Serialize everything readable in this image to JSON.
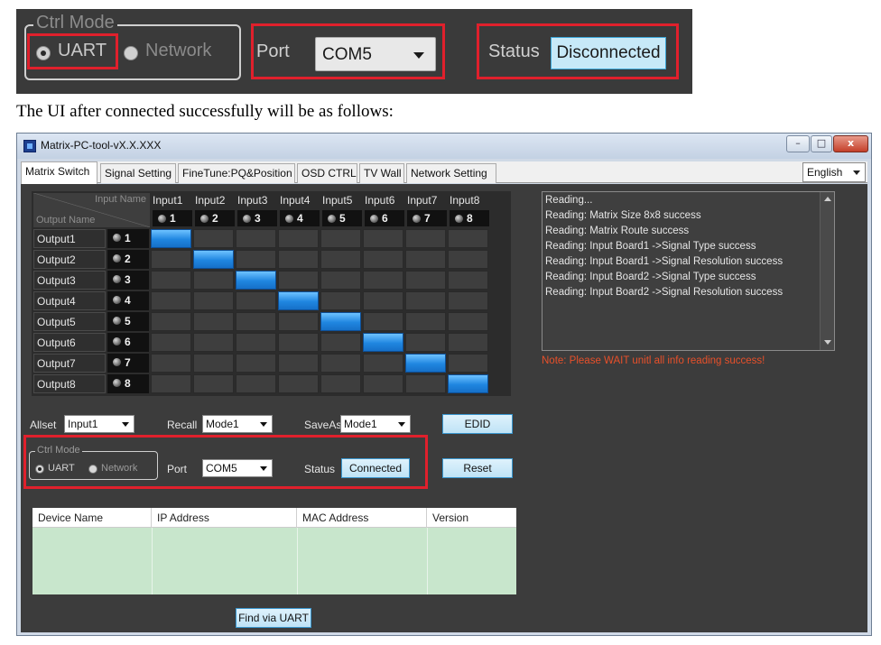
{
  "zoom": {
    "ctrl_mode_legend": "Ctrl Mode",
    "uart_label": "UART",
    "network_label": "Network",
    "port_label": "Port",
    "port_value": "COM5",
    "status_label": "Status",
    "status_value": "Disconnected"
  },
  "caption": "The UI after connected successfully will be as follows:",
  "window": {
    "title": "Matrix-PC-tool-vX.X.XXX",
    "buttons": {
      "minimize": "–",
      "maximize": "□",
      "close": "x"
    }
  },
  "tabs": [
    "Matrix Switch",
    "Signal Setting",
    "FineTune:PQ&Position",
    "OSD CTRL",
    "TV Wall",
    "Network Setting"
  ],
  "active_tab": "Matrix Switch",
  "language": "English",
  "matrix": {
    "corner_input": "Input Name",
    "corner_output": "Output Name",
    "inputs": [
      {
        "name": "Input1",
        "num": "1"
      },
      {
        "name": "Input2",
        "num": "2"
      },
      {
        "name": "Input3",
        "num": "3"
      },
      {
        "name": "Input4",
        "num": "4"
      },
      {
        "name": "Input5",
        "num": "5"
      },
      {
        "name": "Input6",
        "num": "6"
      },
      {
        "name": "Input7",
        "num": "7"
      },
      {
        "name": "Input8",
        "num": "8"
      }
    ],
    "outputs": [
      {
        "name": "Output1",
        "num": "1",
        "route": 1
      },
      {
        "name": "Output2",
        "num": "2",
        "route": 2
      },
      {
        "name": "Output3",
        "num": "3",
        "route": 3
      },
      {
        "name": "Output4",
        "num": "4",
        "route": 4
      },
      {
        "name": "Output5",
        "num": "5",
        "route": 5
      },
      {
        "name": "Output6",
        "num": "6",
        "route": 6
      },
      {
        "name": "Output7",
        "num": "7",
        "route": 7
      },
      {
        "name": "Output8",
        "num": "8",
        "route": 8
      }
    ]
  },
  "controls": {
    "allset_label": "Allset",
    "allset_value": "Input1",
    "recall_label": "Recall",
    "recall_value": "Mode1",
    "saveas_label": "SaveAs",
    "saveas_value": "Mode1",
    "edid_button": "EDID",
    "ctrl_mode_legend": "Ctrl Mode",
    "uart_label": "UART",
    "network_label": "Network",
    "port_label": "Port",
    "port_value": "COM5",
    "status_label": "Status",
    "status_value": "Connected",
    "reset_button": "Reset",
    "find_button": "Find via UART"
  },
  "device_table": {
    "columns": [
      "Device Name",
      "IP Address",
      "MAC Address",
      "Version"
    ]
  },
  "log": {
    "lines": [
      "Reading...",
      "Reading: Matrix Size 8x8 success",
      "Reading: Matrix Route success",
      "Reading: Input Board1 ->Signal Type success",
      "Reading: Input Board1 ->Signal Resolution success",
      "Reading: Input Board2 ->Signal Type success",
      "Reading: Input Board2 ->Signal Resolution success"
    ],
    "note": "Note: Please WAIT unitl all info reading success!"
  },
  "colors": {
    "highlight_red": "#e0202c",
    "route_active": "#1f86e0",
    "note_orange": "#e8502a",
    "panel_dark": "#3c3c3c"
  }
}
